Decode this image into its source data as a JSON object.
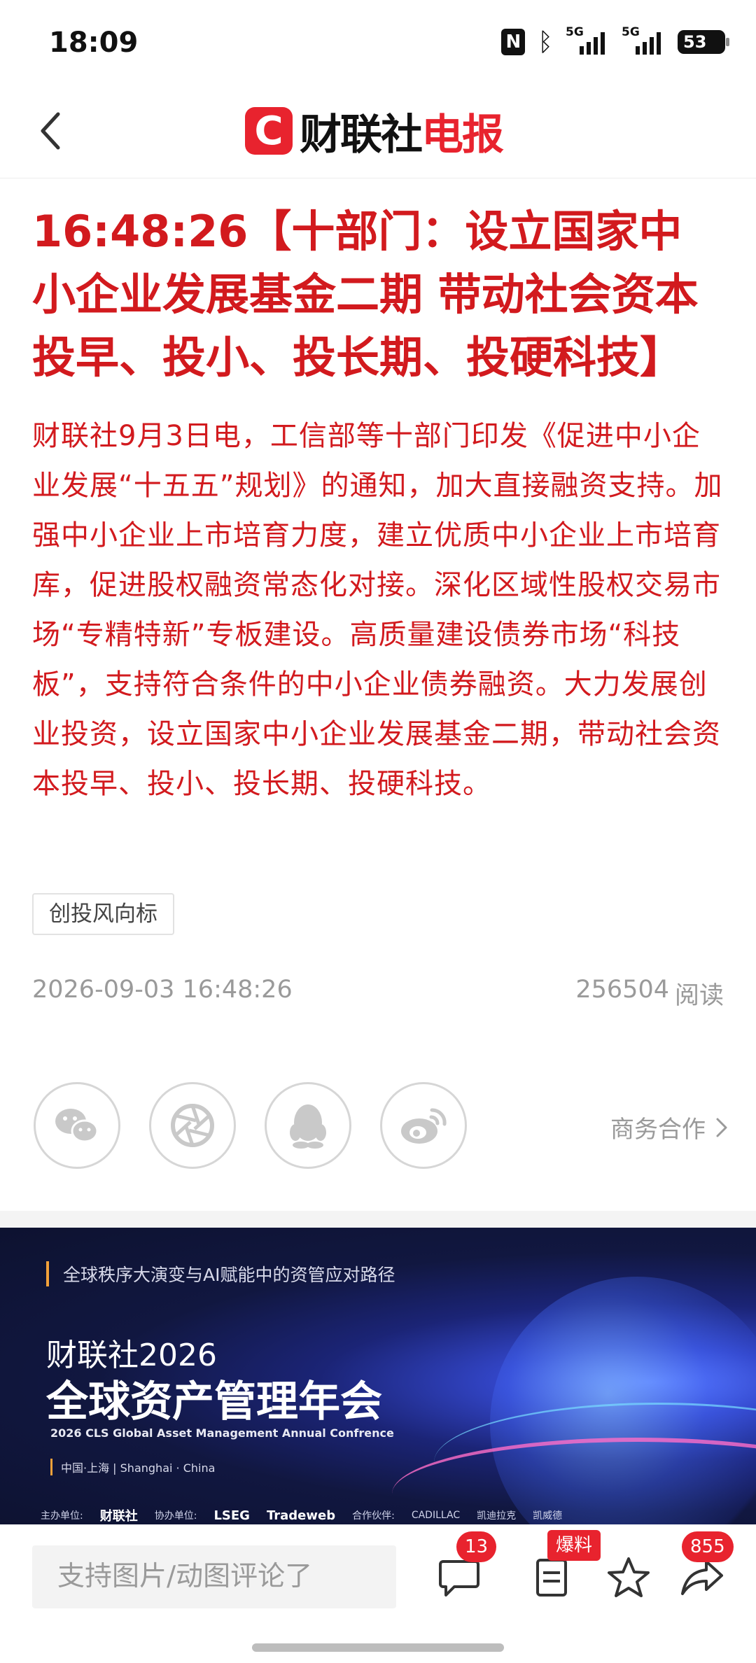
{
  "status_bar": {
    "time": "18:09",
    "network1": "5G",
    "network2": "5G",
    "battery": "53"
  },
  "nav": {
    "brand_logo_letter": "C",
    "brand_name_black": "财联社",
    "brand_name_red": "电报"
  },
  "article": {
    "headline": "16:48:26【十部门：设立国家中小企业发展基金二期 带动社会资本投早、投小、投长期、投硬科技】",
    "body": "财联社9月3日电，工信部等十部门印发《促进中小企业发展“十五五”规划》的通知，加大直接融资支持。加强中小企业上市培育力度，建立优质中小企业上市培育库，促进股权融资常态化对接。深化区域性股权交易市场“专精特新”专板建设。高质量建设债券市场“科技板”，支持符合条件的中小企业债券融资。大力发展创业投资，设立国家中小企业发展基金二期，带动社会资本投早、投小、投长期、投硬科技。",
    "tag": "创投风向标",
    "datetime": "2026-09-03 16:48:26",
    "read_count": "256504",
    "read_label": "阅读"
  },
  "share": {
    "business_label": "商务合作"
  },
  "banner": {
    "tagline": "全球秩序大演变与AI赋能中的资管应对路径",
    "title_line1": "财联社2026",
    "title_line2": "全球资产管理年会",
    "subtitle_en": "2026 CLS Global Asset Management Annual Confrence",
    "location": "中国·上海 | Shanghai · China",
    "host_label": "主办单位:",
    "host_name": "财联社",
    "co_label": "协办单位:",
    "co_1": "LSEG",
    "co_2": "Tradeweb",
    "partner_label": "合作伙伴:",
    "partner_1": "CADILLAC",
    "partner_2": "凯迪拉克",
    "partner_3": "凯威德"
  },
  "bottom_bar": {
    "comment_placeholder": "支持图片/动图评论了",
    "comment_count": "13",
    "tip_badge": "爆料",
    "share_count": "855"
  },
  "colors": {
    "accent_red": "#e8232e",
    "headline_red": "#d21a1e",
    "meta_gray": "#9a9a9a"
  }
}
